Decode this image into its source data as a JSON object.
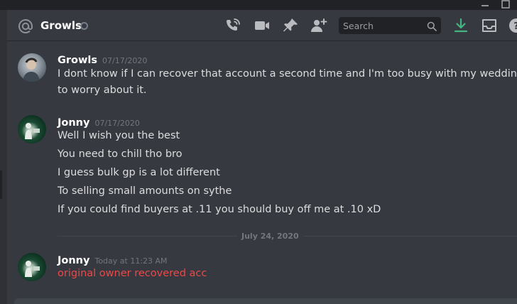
{
  "header": {
    "channel_name": "Growls",
    "search_placeholder": "Search"
  },
  "messages": [
    {
      "username": "Growls",
      "timestamp": "07/17/2020",
      "lines": [
        "I dont know if I can recover that account a second time and I'm too busy with my wedding",
        "to worry about it."
      ]
    },
    {
      "username": "Jonny",
      "timestamp": "07/17/2020",
      "lines": [
        "Well I wish you the best",
        "You need to chill tho bro",
        "I guess bulk gp is a lot different",
        "To selling small amounts on sythe",
        "If you could find buyers at .11 you should buy off me at .10 xD"
      ]
    },
    {
      "username": "Jonny",
      "timestamp": "Today at 11:23 AM",
      "lines": [
        "original owner recovered acc"
      ]
    }
  ],
  "date_divider": "July 24, 2020",
  "icons": {
    "at": "at-icon",
    "call": "phone-call-icon",
    "video": "video-camera-icon",
    "pin": "pin-icon",
    "add_friend": "add-friend-icon",
    "search": "search-icon",
    "download": "download-icon",
    "inbox": "inbox-icon",
    "help": "help-icon"
  },
  "colors": {
    "background": "#36393f",
    "header_text": "#ffffff",
    "message_text": "#dcddde",
    "timestamp": "#72767d",
    "error_text": "#f04747",
    "download_accent": "#43b581"
  }
}
